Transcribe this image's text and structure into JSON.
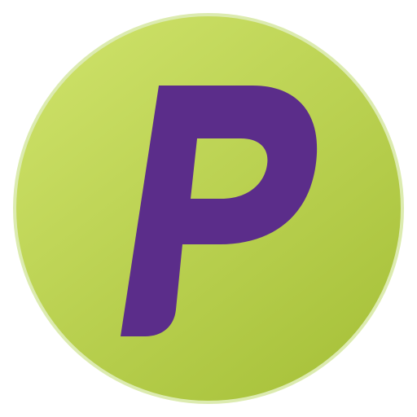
{
  "logo": {
    "letter": "P",
    "description_icon": "p-logo-icon",
    "colors": {
      "circle_light": "#c7dc5f",
      "circle_dark": "#a9c43a",
      "rim": "#dcebb0",
      "letter": "#5b2d8a"
    }
  }
}
